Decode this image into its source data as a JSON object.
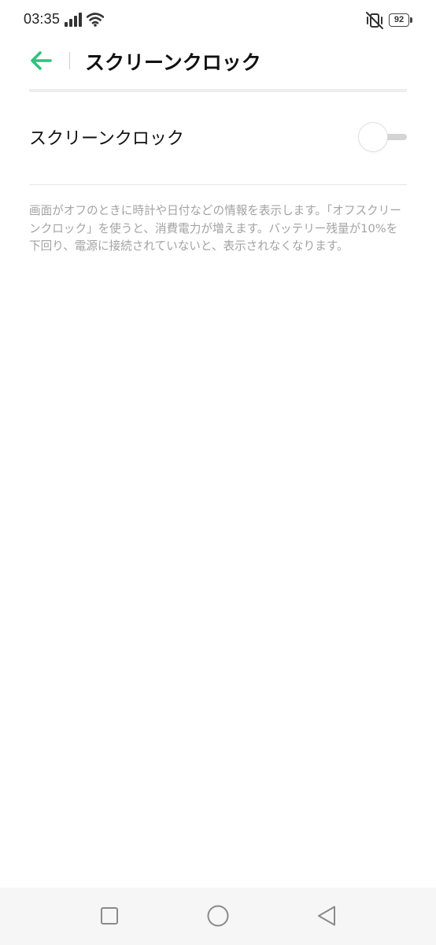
{
  "status_bar": {
    "time": "03:35",
    "battery_level": "92",
    "icons": [
      "signal-icon",
      "wifi-icon",
      "vibrate-mute-icon",
      "battery-icon"
    ]
  },
  "header": {
    "title": "スクリーンクロック",
    "back_icon": "arrow-left-icon"
  },
  "setting": {
    "label": "スクリーンクロック",
    "enabled": false
  },
  "description": "画面がオフのときに時計や日付などの情報を表示します。「オフスクリーンクロック」を使うと、消費電力が増えます。バッテリー残量が10%を下回り、電源に接続されていないと、表示されなくなります。",
  "nav_bar": {
    "icons": [
      "recent-apps-icon",
      "home-icon",
      "back-icon"
    ]
  },
  "colors": {
    "accent": "#2ec27e",
    "text_primary": "#111111",
    "text_secondary": "#a3a3a3",
    "toggle_track_off": "#d4d4d4",
    "nav_background": "#f6f6f6"
  }
}
